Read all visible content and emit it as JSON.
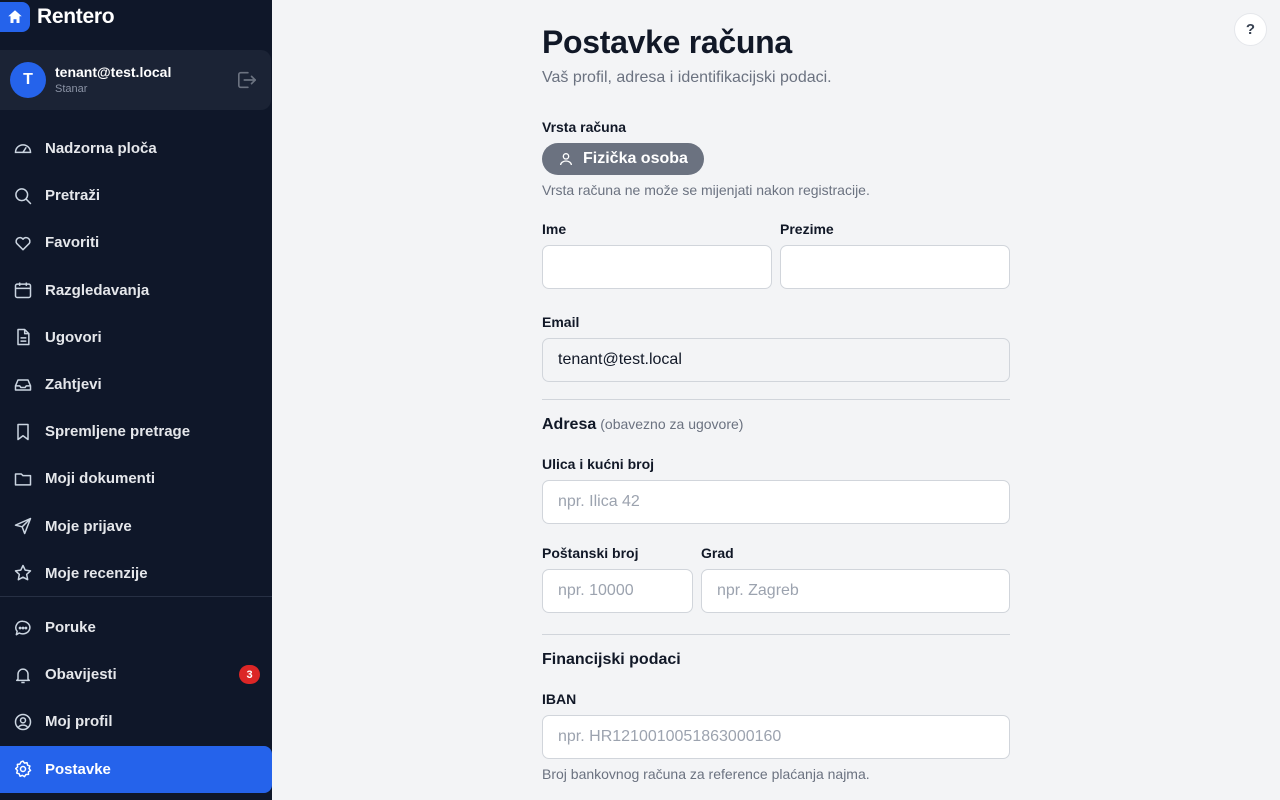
{
  "brand": {
    "name": "Rentero",
    "logo_icon": "home-icon"
  },
  "user": {
    "initial": "T",
    "email": "tenant@test.local",
    "role": "Stanar"
  },
  "nav": {
    "items": [
      {
        "label": "Nadzorna ploča",
        "icon": "dashboard-gauge-icon"
      },
      {
        "label": "Pretraži",
        "icon": "search-icon"
      },
      {
        "label": "Favoriti",
        "icon": "heart-icon"
      },
      {
        "label": "Razgledavanja",
        "icon": "calendar-icon"
      },
      {
        "label": "Ugovori",
        "icon": "document-icon"
      },
      {
        "label": "Zahtjevi",
        "icon": "inbox-icon"
      },
      {
        "label": "Spremljene pretrage",
        "icon": "bookmark-icon"
      },
      {
        "label": "Moji dokumenti",
        "icon": "folder-icon"
      },
      {
        "label": "Moje prijave",
        "icon": "send-icon"
      },
      {
        "label": "Moje recenzije",
        "icon": "star-icon"
      }
    ],
    "secondary": [
      {
        "label": "Poruke",
        "icon": "chat-icon"
      },
      {
        "label": "Obavijesti",
        "icon": "bell-icon",
        "badge": "3"
      },
      {
        "label": "Moj profil",
        "icon": "user-circle-icon"
      },
      {
        "label": "Postavke",
        "icon": "gear-icon",
        "active": true
      }
    ]
  },
  "help_button": "?",
  "page": {
    "title": "Postavke računa",
    "subtitle": "Vaš profil, adresa i identifikacijski podaci."
  },
  "account_type": {
    "label": "Vrsta računa",
    "value": "Fizička osoba",
    "help": "Vrsta računa ne može se mijenjati nakon registracije."
  },
  "fields": {
    "first_name": {
      "label": "Ime",
      "value": ""
    },
    "last_name": {
      "label": "Prezime",
      "value": ""
    },
    "email": {
      "label": "Email",
      "value": "tenant@test.local"
    }
  },
  "address": {
    "title": "Adresa",
    "note": "(obavezno za ugovore)",
    "street": {
      "label": "Ulica i kućni broj",
      "placeholder": "npr. Ilica 42"
    },
    "postal": {
      "label": "Poštanski broj",
      "placeholder": "npr. 10000"
    },
    "city": {
      "label": "Grad",
      "placeholder": "npr. Zagreb"
    }
  },
  "financial": {
    "title": "Financijski podaci",
    "iban": {
      "label": "IBAN",
      "placeholder": "npr. HR1210010051863000160",
      "help": "Broj bankovnog računa za reference plaćanja najma."
    }
  },
  "colors": {
    "sidebar_bg": "#0f1729",
    "accent": "#2563eb",
    "badge": "#dc2626",
    "pill": "#6b7280"
  }
}
